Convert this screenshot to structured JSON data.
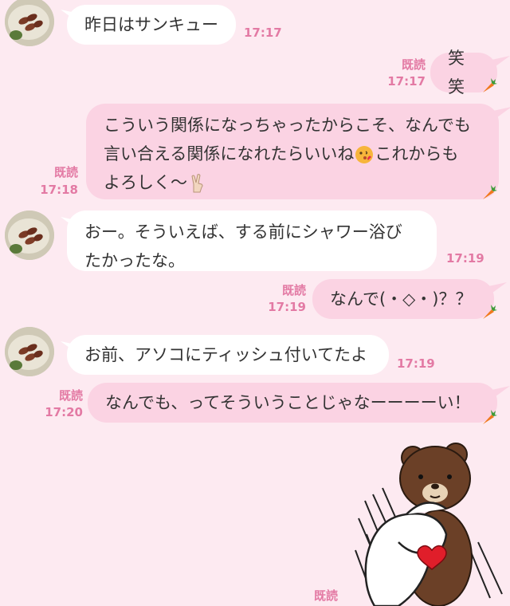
{
  "messages": [
    {
      "text": "昨日はサンキュー",
      "time": "17:17"
    },
    {
      "text": "笑笑",
      "read": "既読",
      "time": "17:17"
    },
    {
      "line1": "こういう関係になっちゃったからこそ、なんでも",
      "line2": "言い合える関係になれたらいいね",
      "line2b": "これからも",
      "line3": "よろしく〜",
      "read": "既読",
      "time": "17:18"
    },
    {
      "line1": "おー。そういえば、する前にシャワー浴び",
      "line2": "たかったな。",
      "time": "17:19"
    },
    {
      "text": "なんで(・◇・)？？",
      "read": "既読",
      "time": "17:19"
    },
    {
      "text": "お前、アソコにティッシュ付いてたよ",
      "time": "17:19"
    },
    {
      "text": "なんでも、ってそういうことじゃなーーーーい！",
      "read": "既読",
      "time": "17:20"
    }
  ],
  "last_read": "既読",
  "icons": {
    "carrot": "carrot-icon",
    "kiss": "kiss-emoji",
    "peace": "peace-emoji"
  },
  "colors": {
    "background": "#fdeaf1",
    "own_bubble": "#fbd3e3",
    "read_label": "#e37aa4"
  }
}
